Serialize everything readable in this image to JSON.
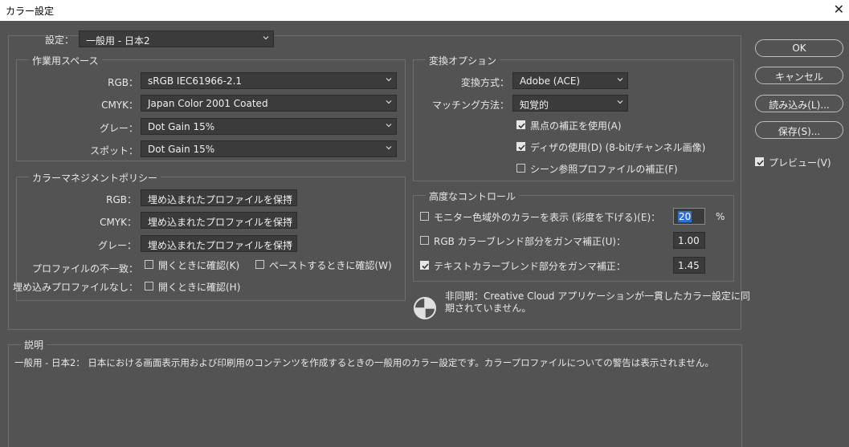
{
  "window": {
    "title": "カラー設定",
    "close_glyph": "✕"
  },
  "settings": {
    "label": "設定：",
    "value": "一般用 - 日本2"
  },
  "working_spaces": {
    "title": "作業用スペース",
    "rgb_label": "RGB：",
    "rgb_value": "sRGB IEC61966-2.1",
    "cmyk_label": "CMYK：",
    "cmyk_value": "Japan Color 2001 Coated",
    "gray_label": "グレー：",
    "gray_value": "Dot Gain 15%",
    "spot_label": "スポット：",
    "spot_value": "Dot Gain 15%"
  },
  "policies": {
    "title": "カラーマネジメントポリシー",
    "rgb_label": "RGB：",
    "rgb_value": "埋め込まれたプロファイルを保持",
    "cmyk_label": "CMYK：",
    "cmyk_value": "埋め込まれたプロファイルを保持",
    "gray_label": "グレー：",
    "gray_value": "埋め込まれたプロファイルを保持",
    "mismatch_label": "プロファイルの不一致：",
    "mismatch_open_label": "開くときに確認(K)",
    "mismatch_open_checked": false,
    "mismatch_paste_label": "ペーストするときに確認(W)",
    "mismatch_paste_checked": false,
    "missing_label": "埋め込みプロファイルなし：",
    "missing_open_label": "開くときに確認(H)",
    "missing_open_checked": false
  },
  "conversion": {
    "title": "変換オプション",
    "engine_label": "変換方式：",
    "engine_value": "Adobe (ACE)",
    "intent_label": "マッチング方法：",
    "intent_value": "知覚的",
    "bpc_label": "黒点の補正を使用(A)",
    "bpc_checked": true,
    "dither_label": "ディザの使用(D) (8-bit/チャンネル画像)",
    "dither_checked": true,
    "scene_label": "シーン参照プロファイルの補正(F)",
    "scene_checked": false
  },
  "advanced": {
    "title": "高度なコントロール",
    "desaturate_label": "モニター色域外のカラーを表示 (彩度を下げる)(E)：",
    "desaturate_checked": false,
    "desaturate_value": "20",
    "desaturate_unit": "%",
    "blend_rgb_label": "RGB カラーブレンド部分をガンマ補正(U)：",
    "blend_rgb_checked": false,
    "blend_rgb_value": "1.00",
    "blend_text_label": "テキストカラーブレンド部分をガンマ補正：",
    "blend_text_checked": true,
    "blend_text_value": "1.45"
  },
  "sync": {
    "line1": "非同期：Creative Cloud アプリケーションが一貫したカラー設定に同",
    "line2": "期されていません。",
    "icon": "sync-status-icon"
  },
  "buttons": {
    "ok": "OK",
    "cancel": "キャンセル",
    "load": "読み込み(L)...",
    "save": "保存(S)...",
    "preview_label": "プレビュー(V)",
    "preview_checked": true
  },
  "description": {
    "title": "説明",
    "text": "一般用 - 日本2： 日本における画面表示用および印刷用のコンテンツを作成するときの一般用のカラー設定です。カラープロファイルについての警告は表示されません。"
  },
  "colors": {
    "background": "#535353",
    "field": "#3b3b3b",
    "accent": "#2f6fd6"
  }
}
